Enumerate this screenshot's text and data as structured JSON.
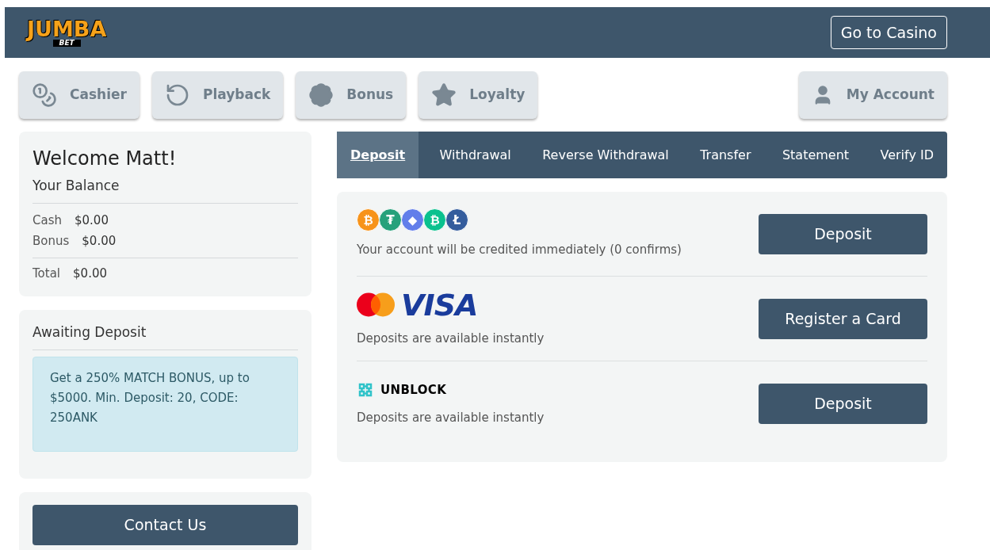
{
  "header": {
    "logo": {
      "word": "JUMBA",
      "sub": "BET"
    },
    "casino_button": "Go to Casino"
  },
  "nav": [
    {
      "kind": "cashier",
      "label": "Cashier"
    },
    {
      "kind": "playback",
      "label": "Playback"
    },
    {
      "kind": "bonus",
      "label": "Bonus"
    },
    {
      "kind": "loyalty",
      "label": "Loyalty"
    }
  ],
  "account_button": "My Account",
  "balance": {
    "welcome": "Welcome Matt!",
    "title": "Your Balance",
    "rows": [
      {
        "label": "Cash",
        "value": "$0.00"
      },
      {
        "label": "Bonus",
        "value": "$0.00"
      }
    ],
    "total": {
      "label": "Total",
      "value": "$0.00"
    }
  },
  "awaiting": {
    "title": "Awaiting Deposit",
    "notice": "Get a 250% MATCH BONUS, up to $5000. Min. Deposit: 20, CODE: 250ANK"
  },
  "contact_button": "Contact Us",
  "tabs": [
    {
      "label": "Deposit",
      "selected": true
    },
    {
      "label": "Withdrawal",
      "selected": false
    },
    {
      "label": "Reverse Withdrawal",
      "selected": false
    },
    {
      "label": "Transfer",
      "selected": false
    },
    {
      "label": "Statement",
      "selected": false
    },
    {
      "label": "Verify ID",
      "selected": false
    }
  ],
  "methods": [
    {
      "kind": "crypto",
      "coins": [
        {
          "symbol": "₿",
          "color": "#f7931a"
        },
        {
          "symbol": "₮",
          "color": "#26a17b"
        },
        {
          "symbol": "◆",
          "color": "#627eea"
        },
        {
          "symbol": "₿",
          "color": "#0ac18e"
        },
        {
          "symbol": "Ł",
          "color": "#345d9d"
        }
      ],
      "note": "Your account will be credited immediately (0 confirms)",
      "button": "Deposit"
    },
    {
      "kind": "card",
      "brand": "VISA",
      "note": "Deposits are available instantly",
      "button": "Register a Card"
    },
    {
      "kind": "unblock",
      "brand": "UNBLOCK",
      "note": "Deposits are available instantly",
      "button": "Deposit"
    }
  ]
}
